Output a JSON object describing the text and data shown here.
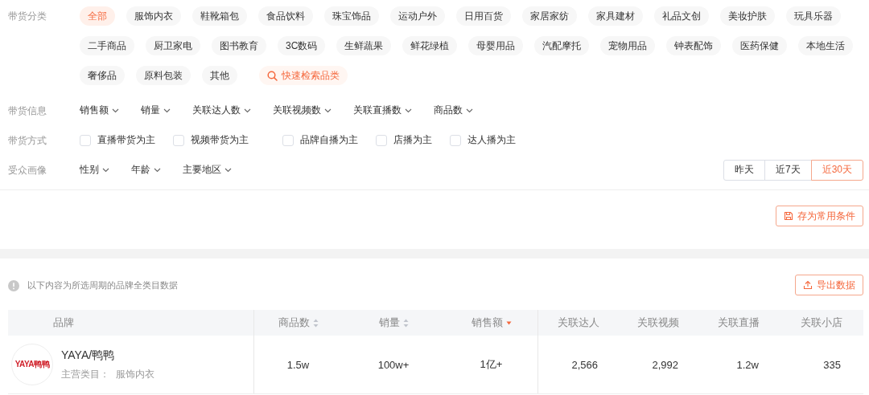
{
  "category_filter": {
    "label": "带货分类",
    "rows": [
      [
        {
          "kind": "chip",
          "label": "全部",
          "selected": true
        },
        {
          "kind": "chip",
          "label": "服饰内衣",
          "selected": false
        },
        {
          "kind": "chip",
          "label": "鞋靴箱包",
          "selected": false
        },
        {
          "kind": "chip",
          "label": "食品饮料",
          "selected": false
        },
        {
          "kind": "chip",
          "label": "珠宝饰品",
          "selected": false
        },
        {
          "kind": "chip",
          "label": "运动户外",
          "selected": false
        },
        {
          "kind": "chip",
          "label": "日用百货",
          "selected": false
        },
        {
          "kind": "chip",
          "label": "家居家纺",
          "selected": false
        },
        {
          "kind": "chip",
          "label": "家具建材",
          "selected": false
        },
        {
          "kind": "chip",
          "label": "礼品文创",
          "selected": false
        },
        {
          "kind": "chip",
          "label": "美妆护肤",
          "selected": false
        },
        {
          "kind": "chip",
          "label": "玩具乐器",
          "selected": false
        }
      ],
      [
        {
          "kind": "chip",
          "label": "二手商品",
          "selected": false
        },
        {
          "kind": "chip",
          "label": "厨卫家电",
          "selected": false
        },
        {
          "kind": "chip",
          "label": "图书教育",
          "selected": false
        },
        {
          "kind": "chip",
          "label": "3C数码",
          "selected": false
        },
        {
          "kind": "chip",
          "label": "生鲜蔬果",
          "selected": false
        },
        {
          "kind": "chip",
          "label": "鲜花绿植",
          "selected": false
        },
        {
          "kind": "chip",
          "label": "母婴用品",
          "selected": false
        },
        {
          "kind": "chip",
          "label": "汽配摩托",
          "selected": false
        },
        {
          "kind": "chip",
          "label": "宠物用品",
          "selected": false
        },
        {
          "kind": "chip",
          "label": "钟表配饰",
          "selected": false
        },
        {
          "kind": "chip",
          "label": "医药保健",
          "selected": false
        },
        {
          "kind": "chip",
          "label": "本地生活",
          "selected": false
        }
      ],
      [
        {
          "kind": "chip",
          "label": "奢侈品",
          "selected": false
        },
        {
          "kind": "chip",
          "label": "原料包装",
          "selected": false
        },
        {
          "kind": "chip",
          "label": "其他",
          "selected": false
        },
        {
          "kind": "search",
          "label": "快速检索品类"
        }
      ]
    ]
  },
  "info_filter": {
    "label": "带货信息",
    "dropdowns": [
      "销售额",
      "销量",
      "关联达人数",
      "关联视频数",
      "关联直播数",
      "商品数"
    ]
  },
  "mode_filter": {
    "label": "带货方式",
    "options": [
      {
        "label": "直播带货为主",
        "checked": false
      },
      {
        "label": "视频带货为主",
        "checked": false
      },
      {
        "label": "品牌自播为主",
        "checked": false
      },
      {
        "label": "店播为主",
        "checked": false
      },
      {
        "label": "达人播为主",
        "checked": false
      }
    ]
  },
  "audience_filter": {
    "label": "受众画像",
    "dropdowns": [
      "性别",
      "年龄",
      "主要地区"
    ]
  },
  "period_tabs": [
    {
      "label": "昨天",
      "selected": false
    },
    {
      "label": "近7天",
      "selected": false
    },
    {
      "label": "近30天",
      "selected": true
    }
  ],
  "save_button": "存为常用条件",
  "notice": "以下内容为所选周期的品牌全类目数据",
  "export_button": "导出数据",
  "table": {
    "columns": [
      {
        "label": "品牌"
      },
      {
        "label": "商品数",
        "sorted": false
      },
      {
        "label": "销量",
        "sorted": false
      },
      {
        "label": "销售额",
        "sorted": true
      },
      {
        "label": "关联达人"
      },
      {
        "label": "关联视频"
      },
      {
        "label": "关联直播"
      },
      {
        "label": "关联小店"
      }
    ],
    "rows": [
      {
        "cells": [
          {
            "logo_text": "YAYA鸭鸭",
            "name": "YAYA/鸭鸭",
            "category_label": "主营类目：",
            "category": "服饰内衣"
          },
          "1.5w",
          "100w+",
          "1亿+",
          "2,566",
          "2,992",
          "1.2w",
          "335"
        ]
      }
    ]
  }
}
